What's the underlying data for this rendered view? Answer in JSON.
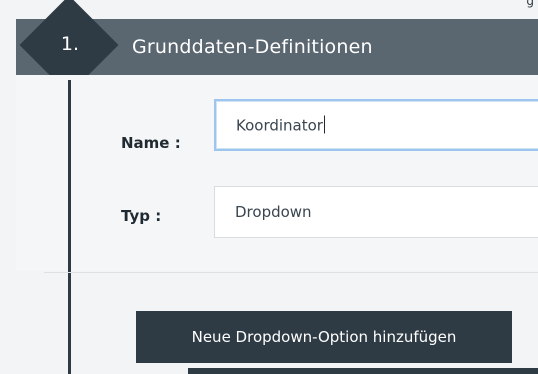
{
  "top_fragment": "g",
  "section": {
    "step_number": "1.",
    "title": "Grunddaten-Definitionen"
  },
  "form": {
    "name_label": "Name :",
    "name_value": "Koordinator",
    "type_label": "Typ :",
    "type_value": "Dropdown"
  },
  "actions": {
    "add_option_label": "Neue Dropdown-Option hinzufügen"
  },
  "colors": {
    "header_bg": "#5a6670",
    "accent_dark": "#2e3a44",
    "focus_border": "#9ec5ee"
  }
}
